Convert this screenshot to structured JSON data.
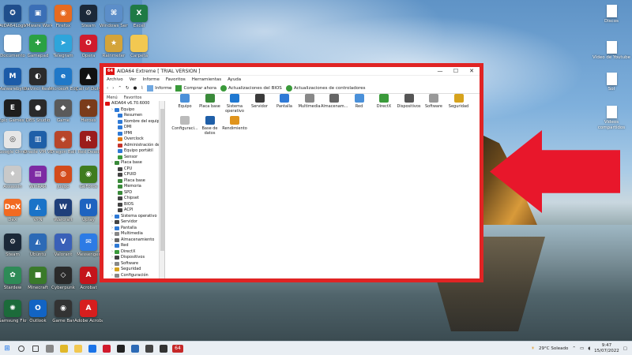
{
  "desktop": {
    "left_icons": [
      {
        "label": "AIDA64Logo",
        "color": "#1f4e8c",
        "glyph": "✪"
      },
      {
        "label": "VMware Workstation",
        "color": "#3b6fb6",
        "glyph": "▣"
      },
      {
        "label": "Firefox",
        "color": "#e86b20",
        "glyph": "◉"
      },
      {
        "label": "Steam",
        "color": "#1b2838",
        "glyph": "⚙"
      },
      {
        "label": "Windows Server",
        "color": "#5c8ec9",
        "glyph": "⌘"
      },
      {
        "label": "Excel",
        "color": "#1f7a45",
        "glyph": "X"
      },
      {
        "label": "Documento",
        "color": "#ffffff",
        "glyph": ""
      },
      {
        "label": "Gamepad",
        "color": "#2aa142",
        "glyph": "✚"
      },
      {
        "label": "Telegram",
        "color": "#2ea5db",
        "glyph": "➤"
      },
      {
        "label": "Opera",
        "color": "#d11b2d",
        "glyph": "O"
      },
      {
        "label": "Rainmeter",
        "color": "#d4a43a",
        "glyph": "★"
      },
      {
        "label": "Carpeta",
        "color": "#f2c851",
        "glyph": ""
      },
      {
        "label": "Malwarebytes",
        "color": "#1b5ba8",
        "glyph": "M"
      },
      {
        "label": "DaVinci Resolve",
        "color": "#2b2b2b",
        "glyph": "◐"
      },
      {
        "label": "Microsoft Edge",
        "color": "#1f78c8",
        "glyph": "e"
      },
      {
        "label": "Call of Duty",
        "color": "#111111",
        "glyph": "▲"
      },
      {
        "label": "Epic Games Launcher",
        "color": "#1d1d1d",
        "glyph": "E"
      },
      {
        "label": "OBS Studio",
        "color": "#2a2a2a",
        "glyph": "●"
      },
      {
        "label": "Game",
        "color": "#5a5a5a",
        "glyph": "◆"
      },
      {
        "label": "Heroes",
        "color": "#7a3b1a",
        "glyph": "✦"
      },
      {
        "label": "Google Chrome",
        "color": "#e6e6e6",
        "glyph": "◎"
      },
      {
        "label": "Oracle VM VirtualBox",
        "color": "#1e5fa8",
        "glyph": "▥"
      },
      {
        "label": "Dragon Ball",
        "color": "#b8452a",
        "glyph": "◈"
      },
      {
        "label": "Red Dead",
        "color": "#9b1c1c",
        "glyph": "R"
      },
      {
        "label": "Assassin",
        "color": "#c9c9c9",
        "glyph": "♦"
      },
      {
        "label": "WinRAR",
        "color": "#7d2aa3",
        "glyph": "▤"
      },
      {
        "label": "Juego",
        "color": "#d34b1b",
        "glyph": "◍"
      },
      {
        "label": "GeForce",
        "color": "#3f7c1f",
        "glyph": "◉"
      },
      {
        "label": "DeX",
        "color": "#f26a21",
        "glyph": "DeX"
      },
      {
        "label": "VPN",
        "color": "#1a73c8",
        "glyph": "◭"
      },
      {
        "label": "Warcraft",
        "color": "#1f3f7a",
        "glyph": "W"
      },
      {
        "label": "Uplay",
        "color": "#1e63c0",
        "glyph": "U"
      },
      {
        "label": "Steam",
        "color": "#1b2838",
        "glyph": "⚙"
      },
      {
        "label": "Ubuntu",
        "color": "#2c6ab6",
        "glyph": "◭"
      },
      {
        "label": "Valorant",
        "color": "#3a60b8",
        "glyph": "V"
      },
      {
        "label": "Messenger",
        "color": "#2c7be5",
        "glyph": "✉"
      },
      {
        "label": "Stardew",
        "color": "#2e8b57",
        "glyph": "✿"
      },
      {
        "label": "Minecraft",
        "color": "#3a7a2a",
        "glyph": "■"
      },
      {
        "label": "Cyberpunk",
        "color": "#2a2a2a",
        "glyph": "◇"
      },
      {
        "label": "Acrobat",
        "color": "#c4141b",
        "glyph": "A"
      },
      {
        "label": "Samsung Flow",
        "color": "#1c6b3a",
        "glyph": "✺"
      },
      {
        "label": "Outlook",
        "color": "#1264c4",
        "glyph": "O"
      },
      {
        "label": "Game Bar",
        "color": "#333333",
        "glyph": "◉"
      },
      {
        "label": "Adobe Acrobat",
        "color": "#d71e1e",
        "glyph": "A"
      }
    ],
    "right_icons": [
      {
        "label": "Discos"
      },
      {
        "label": "Vídeo de Youtube"
      },
      {
        "label": "Sol"
      },
      {
        "label": "Videos compartidos"
      }
    ]
  },
  "app": {
    "logo": "64",
    "title": "AIDA64 Extreme  [ TRIAL VERSION ]",
    "window_controls": {
      "minimize": "—",
      "maximize": "☐",
      "close": "✕"
    },
    "menu": [
      "Archivo",
      "Ver",
      "Informe",
      "Favoritos",
      "Herramientas",
      "Ayuda"
    ],
    "toolbar": {
      "report": "Informe",
      "buy": "Comprar ahora",
      "bios_updates": "Actualizaciones del BIOS",
      "driver_updates": "Actualizaciones de controladores"
    },
    "tabs": [
      "Menú",
      "Favoritos"
    ],
    "tree": [
      {
        "label": "AIDA64 v6.70.6000",
        "indent": 0,
        "color": "#d11"
      },
      {
        "label": "Equipo",
        "indent": 1,
        "color": "#2f7ad6"
      },
      {
        "label": "Resumen",
        "indent": 2,
        "color": "#2f7ad6"
      },
      {
        "label": "Nombre del equipo",
        "indent": 2,
        "color": "#2f7ad6"
      },
      {
        "label": "DMI",
        "indent": 2,
        "color": "#2f7ad6"
      },
      {
        "label": "IPMI",
        "indent": 2,
        "color": "#2f7ad6"
      },
      {
        "label": "Overclock",
        "indent": 2,
        "color": "#e07a12"
      },
      {
        "label": "Administración de e",
        "indent": 2,
        "color": "#c6342b"
      },
      {
        "label": "Equipo portátil",
        "indent": 2,
        "color": "#2f7ad6"
      },
      {
        "label": "Sensor",
        "indent": 2,
        "color": "#3a9a3a"
      },
      {
        "label": "Placa base",
        "indent": 1,
        "color": "#3a8a3a"
      },
      {
        "label": "CPU",
        "indent": 2,
        "color": "#444"
      },
      {
        "label": "CPUID",
        "indent": 2,
        "color": "#444"
      },
      {
        "label": "Placa base",
        "indent": 2,
        "color": "#3a8a3a"
      },
      {
        "label": "Memoria",
        "indent": 2,
        "color": "#3a8a3a"
      },
      {
        "label": "SPD",
        "indent": 2,
        "color": "#3a8a3a"
      },
      {
        "label": "Chipset",
        "indent": 2,
        "color": "#444"
      },
      {
        "label": "BIOS",
        "indent": 2,
        "color": "#444"
      },
      {
        "label": "ACPI",
        "indent": 2,
        "color": "#444"
      },
      {
        "label": "Sistema operativo",
        "indent": 1,
        "color": "#2f7ad6"
      },
      {
        "label": "Servidor",
        "indent": 1,
        "color": "#444"
      },
      {
        "label": "Pantalla",
        "indent": 1,
        "color": "#2f7ad6"
      },
      {
        "label": "Multimedia",
        "indent": 1,
        "color": "#888"
      },
      {
        "label": "Almacenamiento",
        "indent": 1,
        "color": "#666"
      },
      {
        "label": "Red",
        "indent": 1,
        "color": "#2f7ad6"
      },
      {
        "label": "DirectX",
        "indent": 1,
        "color": "#3a9a3a"
      },
      {
        "label": "Dispositivos",
        "indent": 1,
        "color": "#444"
      },
      {
        "label": "Software",
        "indent": 1,
        "color": "#888"
      },
      {
        "label": "Seguridad",
        "indent": 1,
        "color": "#d6a21c"
      },
      {
        "label": "Configuración",
        "indent": 1,
        "color": "#888"
      }
    ],
    "categories": [
      {
        "label": "Equipo",
        "color": "#4a90d9"
      },
      {
        "label": "Placa base",
        "color": "#3a8a3a"
      },
      {
        "label": "Sistema operativo",
        "color": "#1f78d1"
      },
      {
        "label": "Servidor",
        "color": "#3a3a3a"
      },
      {
        "label": "Pantalla",
        "color": "#2f7ad6"
      },
      {
        "label": "Multimedia",
        "color": "#888888"
      },
      {
        "label": "Almacenam...",
        "color": "#666666"
      },
      {
        "label": "Red",
        "color": "#4a90d9"
      },
      {
        "label": "DirectX",
        "color": "#3a9a3a"
      },
      {
        "label": "Dispositivos",
        "color": "#555555"
      },
      {
        "label": "Software",
        "color": "#999999"
      },
      {
        "label": "Seguridad",
        "color": "#d6a21c"
      },
      {
        "label": "Configuraci...",
        "color": "#bbbbbb"
      },
      {
        "label": "Base de datos",
        "color": "#1f5fa8"
      },
      {
        "label": "Rendimiento",
        "color": "#e0941c"
      }
    ]
  },
  "taskbar": {
    "start": "⊞",
    "apps": [
      {
        "name": "search",
        "color": "#444"
      },
      {
        "name": "task-view",
        "color": "#444"
      },
      {
        "name": "file",
        "color": "#888"
      },
      {
        "name": "notes",
        "color": "#e0b82a"
      },
      {
        "name": "folder",
        "color": "#f2c851"
      },
      {
        "name": "chrome",
        "color": "#1a73e8"
      },
      {
        "name": "app",
        "color": "#d11b2d"
      },
      {
        "name": "obs",
        "color": "#222"
      },
      {
        "name": "vm",
        "color": "#2c6ab6"
      },
      {
        "name": "vmware",
        "color": "#444"
      },
      {
        "name": "terminal",
        "color": "#333"
      },
      {
        "name": "aida64",
        "color": "#c62828"
      }
    ],
    "aida_label": "64",
    "weather": "29°C  Soleado",
    "time": "9:47",
    "date": "15/07/2022"
  }
}
